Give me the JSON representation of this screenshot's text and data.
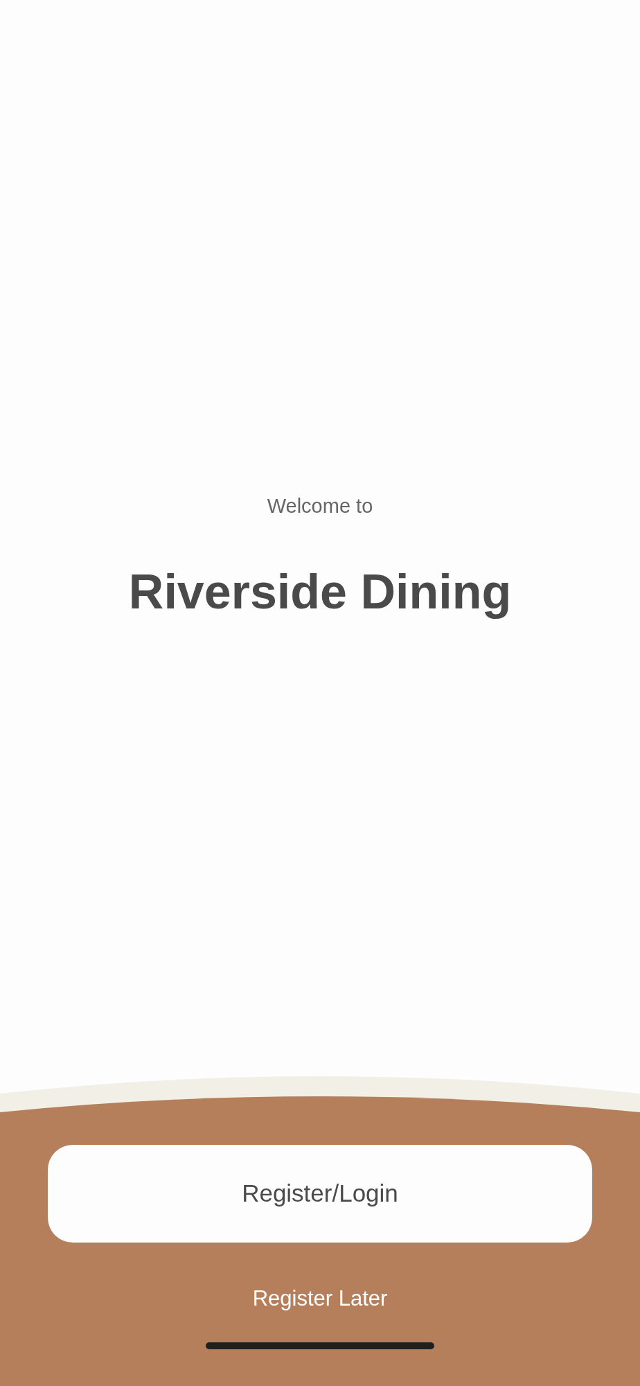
{
  "welcome": {
    "subtitle": "Welcome to",
    "title": "Riverside Dining"
  },
  "actions": {
    "primary": "Register/Login",
    "secondary": "Register Later"
  }
}
